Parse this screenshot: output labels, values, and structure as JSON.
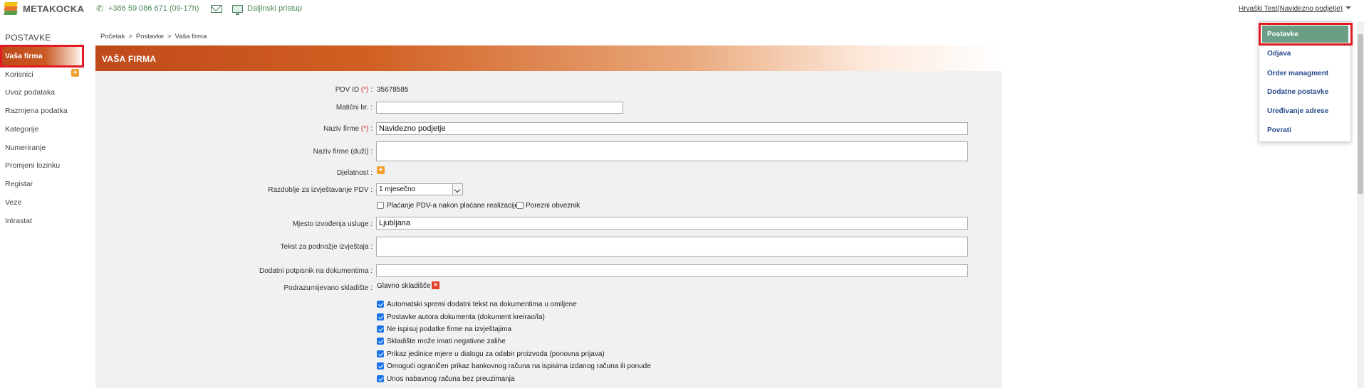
{
  "header": {
    "logo_text": "METAKOCKA",
    "phone": "+386 59 086 671",
    "phone_hours": "(09-17h)",
    "remote_label": "Daljinski pristup",
    "user_menu_label": "Hrvaški Test(Navidezno podjetje)"
  },
  "sidebar": {
    "title": "POSTAVKE",
    "items": [
      {
        "label": "Vaša firma",
        "active": true
      },
      {
        "label": "Korisnici"
      },
      {
        "label": "Uvoz podataka"
      },
      {
        "label": "Razmjena podatka"
      },
      {
        "label": "Kategorije"
      },
      {
        "label": "Numeriranje"
      },
      {
        "label": "Promjeni lozinku"
      },
      {
        "label": "Registar"
      },
      {
        "label": "Veze"
      },
      {
        "label": "Intrastat"
      }
    ]
  },
  "breadcrumb": {
    "items": [
      "Početak",
      "Postavke",
      "Vaša firma"
    ],
    "separator": ">"
  },
  "panel": {
    "title": "VAŠA FIRMA"
  },
  "form": {
    "pdv_id": {
      "label": "PDV ID",
      "required": "(*)",
      "value": "35678585"
    },
    "maticni": {
      "label": "Matični br. :",
      "value": ""
    },
    "naziv": {
      "label": "Naziv firme",
      "required": "(*)",
      "value": "Navidezno podjetje"
    },
    "naziv_duzi": {
      "label": "Naziv firme (duži) :",
      "value": ""
    },
    "djelatnost": {
      "label": "Djelatnost :"
    },
    "razdoblje": {
      "label": "Razdoblje za izvještavanje PDV :",
      "value": "1 mjesečno"
    },
    "placanje_pdv": {
      "label": "Plaćanje PDV-a nakon plaćane realizacije",
      "checked": false
    },
    "porezni": {
      "label": "Porezni obveznik",
      "checked": false
    },
    "mjesto": {
      "label": "Mjesto izvođenja usluge :",
      "value": "Ljubljana"
    },
    "tekst_podnozje": {
      "label": "Tekst za podnožje izvještaja :",
      "value": ""
    },
    "dodatni_potpisnik": {
      "label": "Dodatni potpisnik na dokumentima :",
      "value": ""
    },
    "skladiste": {
      "label": "Podrazumijevano skladište :",
      "value": "Glavno skladišče"
    },
    "checkboxes": [
      {
        "label": "Automatski spremi dodatni tekst na dokumentima u omiljene",
        "checked": true
      },
      {
        "label": "Postavke autora dokumenta (dokument kreirao/la)",
        "checked": true
      },
      {
        "label": "Ne ispisuj podatke firme na izvještajima",
        "checked": true
      },
      {
        "label": "Skladište može imati negativne zalihe",
        "checked": true
      },
      {
        "label": "Prikaz jedinice mjere u dialogu za odabir proizvoda (ponovna prijava)",
        "checked": true
      },
      {
        "label": "Omogući ograničen prikaz bankovnog računa na ispisima izdanog računa ili ponude",
        "checked": true
      },
      {
        "label": "Unos nabavnog računa bez preuzimanja",
        "checked": true
      }
    ]
  },
  "dropdown_menu": {
    "items": [
      {
        "label": "Postavke",
        "active": true
      },
      {
        "label": "Odjava"
      },
      {
        "label": "Order managment"
      },
      {
        "label": "Dodatne postavke"
      },
      {
        "label": "Uređivanje adrese"
      },
      {
        "label": "Povrati"
      }
    ]
  },
  "colors": {
    "accent_orange": "#c0491a",
    "menu_active_green": "#6a9e85",
    "link_blue": "#2b4c8c",
    "highlight_red": "#e21b22",
    "phone_green": "#4a8a5a"
  }
}
